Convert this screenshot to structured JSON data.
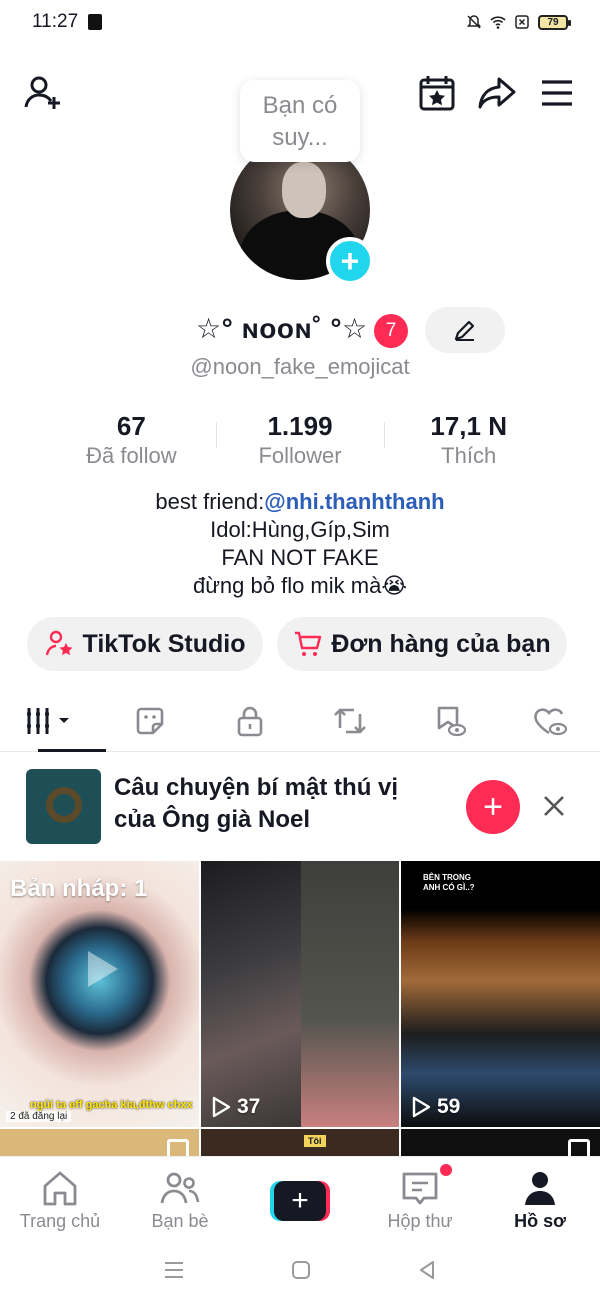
{
  "status_bar": {
    "time": "11:27",
    "battery": "79"
  },
  "profile": {
    "suggestion_bubble": "Bạn có suy...",
    "display_name": "☆° ɴᴏᴏɴ˚ °☆",
    "notification_count": "7",
    "handle": "@noon_fake_emojicat",
    "stats": [
      {
        "value": "67",
        "label": "Đã follow"
      },
      {
        "value": "1.199",
        "label": "Follower"
      },
      {
        "value": "17,1 N",
        "label": "Thích"
      }
    ],
    "bio": {
      "line1_prefix": "best friend:",
      "line1_link": "@nhi.thanhthanh",
      "line2": "Idol:Hùng,Gíp,Sim",
      "line3": "FAN NOT FAKE",
      "line4": "đừng bỏ flo mik mà😭"
    }
  },
  "actions": {
    "studio": "TikTok Studio",
    "orders": "Đơn hàng của bạn"
  },
  "promo": {
    "text": "Câu chuyện bí mật thú vị của Ông già Noel"
  },
  "grid": {
    "draft_label": "Bản nháp: 1",
    "draft_caption": "ngủi ta eff gacha kìa,đthw chxx",
    "draft_meta": "2 đã đăng lại",
    "video2_views": "37",
    "video3_views": "59",
    "video3_text": "BÊN TRONG ANH CÓ GÌ..?",
    "video5_tag": "Tôi"
  },
  "nav": {
    "home": "Trang chủ",
    "friends": "Bạn bè",
    "inbox": "Hộp thư",
    "profile": "Hồ sơ"
  },
  "colors": {
    "accent": "#fe2c55",
    "cyan": "#20d5ec",
    "link": "#2b5db9"
  }
}
